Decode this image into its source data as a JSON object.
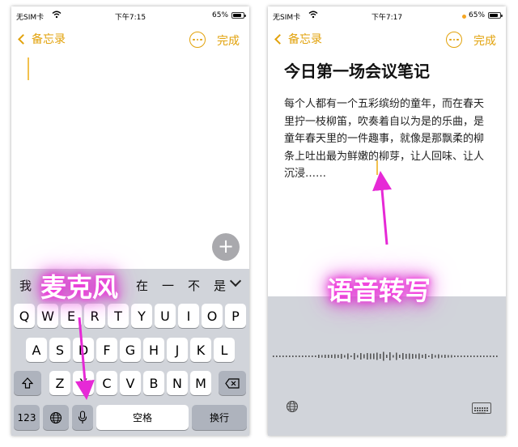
{
  "left_screen": {
    "status": {
      "carrier": "无SIM卡",
      "time": "下午7:15",
      "battery": "65%"
    },
    "nav": {
      "back": "备忘录",
      "done": "完成"
    },
    "fab_symbol": "+",
    "candidates": [
      "我",
      "在",
      "一",
      "不",
      "是"
    ],
    "keyboard": {
      "row1": [
        "Q",
        "W",
        "E",
        "R",
        "T",
        "Y",
        "U",
        "I",
        "O",
        "P"
      ],
      "row2": [
        "A",
        "S",
        "D",
        "F",
        "G",
        "H",
        "J",
        "K",
        "L"
      ],
      "row3": [
        "Z",
        "X",
        "C",
        "V",
        "B",
        "N",
        "M"
      ],
      "numbers_key": "123",
      "space_key": "空格",
      "return_key": "换行"
    },
    "annotation": "麦克风"
  },
  "right_screen": {
    "status": {
      "carrier": "无SIM卡",
      "time": "下午7:17",
      "battery": "65%"
    },
    "nav": {
      "back": "备忘录",
      "done": "完成"
    },
    "note_title": "今日第一场会议笔记",
    "note_body": "每个人都有一个五彩缤纷的童年，而在春天里拧一枝柳笛，吹奏着自以为是的乐曲，是童年春天里的一件趣事，就像是那飘柔的柳条上吐出最为鲜嫩的柳芽，让人回味、让人沉浸……",
    "annotation": "语音转写"
  },
  "colors": {
    "accent": "#e2a20b",
    "keyboard_bg": "#d1d4da",
    "annotation_arrow": "#e629d6",
    "annotation_glow": "#d21cc8"
  },
  "icons": {
    "wifi": "wifi-icon",
    "battery": "battery-icon",
    "back": "chevron-left-icon",
    "more": "ellipsis-circle-icon",
    "add": "plus-icon",
    "shift": "shift-icon",
    "delete": "delete-icon",
    "globe": "globe-icon",
    "mic": "microphone-icon",
    "keyboard": "keyboard-icon"
  }
}
